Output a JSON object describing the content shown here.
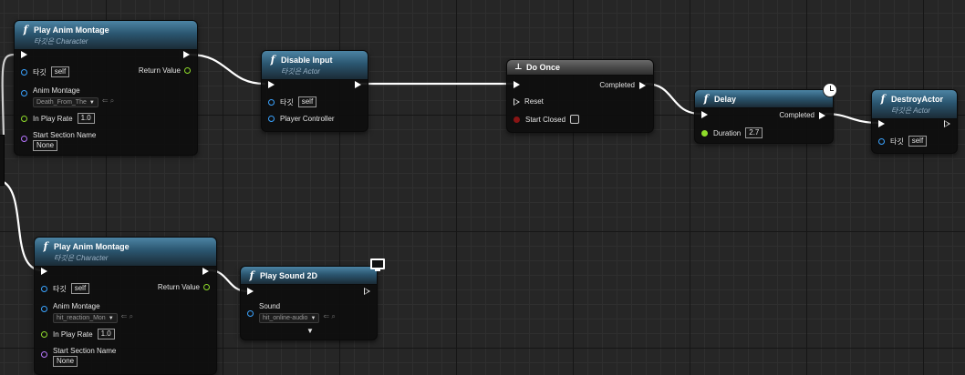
{
  "nodes": {
    "play_montage_1": {
      "title": "Play Anim Montage",
      "subtitle": "타깃은 Character",
      "target_label": "타깃",
      "target_value": "self",
      "return_label": "Return Value",
      "montage_label": "Anim Montage",
      "montage_value": "Death_From_The",
      "play_rate_label": "In Play Rate",
      "play_rate_value": "1.0",
      "section_label": "Start Section Name",
      "section_value": "None"
    },
    "disable_input": {
      "title": "Disable Input",
      "subtitle": "타깃은 Actor",
      "target_label": "타깃",
      "target_value": "self",
      "controller_label": "Player Controller"
    },
    "do_once": {
      "title": "Do Once",
      "completed_label": "Completed",
      "reset_label": "Reset",
      "start_closed_label": "Start Closed"
    },
    "delay": {
      "title": "Delay",
      "completed_label": "Completed",
      "duration_label": "Duration",
      "duration_value": "2.7"
    },
    "destroy_actor": {
      "title": "DestroyActor",
      "subtitle": "타깃은 Actor",
      "target_label": "타깃",
      "target_value": "self"
    },
    "play_montage_2": {
      "title": "Play Anim Montage",
      "subtitle": "타깃은 Character",
      "target_label": "타깃",
      "target_value": "self",
      "return_label": "Return Value",
      "montage_label": "Anim Montage",
      "montage_value": "hit_reaction_Mon",
      "play_rate_label": "In Play Rate",
      "play_rate_value": "1.0",
      "section_label": "Start Section Name",
      "section_value": "None"
    },
    "play_sound": {
      "title": "Play Sound 2D",
      "sound_label": "Sound",
      "sound_value": "hit_online-audio"
    }
  },
  "colors": {
    "exec_pin": "#ffffff",
    "object_pin": "#3aa3ff",
    "float_pin": "#8fdc2a",
    "name_pin": "#b574ff",
    "bool_pin": "#8a1515",
    "wire": "#ffffff",
    "function_header": "#2b5670",
    "macro_header": "#4a4a4a"
  },
  "icons": {
    "function": "function-icon",
    "macro": "macro-icon",
    "latent": "clock-icon",
    "client_only": "monitor-icon"
  }
}
